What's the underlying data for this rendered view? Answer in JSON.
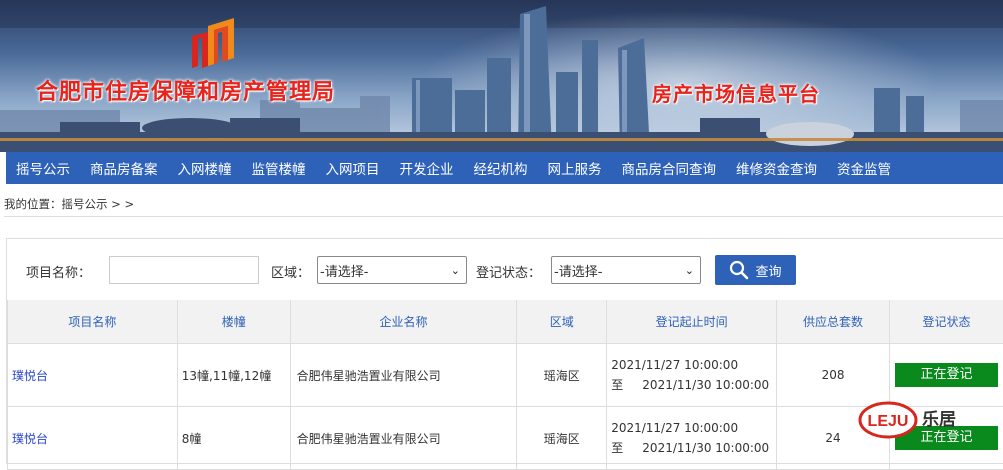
{
  "banner": {
    "title_left": "合肥市住房保障和房产管理局",
    "title_right": "房产市场信息平台",
    "logo_icon": "building-logo-icon"
  },
  "nav": {
    "items": [
      "摇号公示",
      "商品房备案",
      "入网楼幢",
      "监管楼幢",
      "入网项目",
      "开发企业",
      "经纪机构",
      "网上服务",
      "商品房合同查询",
      "维修资金查询",
      "资金监管"
    ]
  },
  "breadcrumb": "我的位置：摇号公示 > >",
  "search": {
    "project_label": "项目名称：",
    "project_value": "",
    "area_label": "区域：",
    "area_selected": "-请选择-",
    "status_label": "登记状态：",
    "status_selected": "-请选择-",
    "button_label": "查询"
  },
  "table": {
    "headers": [
      "项目名称",
      "楼幢",
      "企业名称",
      "区域",
      "登记起止时间",
      "供应总套数",
      "登记状态"
    ],
    "rows": [
      {
        "project": "璞悦台",
        "buildings": "13幢,11幢,12幢",
        "company": "合肥伟星驰浩置业有限公司",
        "area": "瑶海区",
        "start": "2021/11/27 10:00:00",
        "to": "至",
        "end": "2021/11/30 10:00:00",
        "total": "208",
        "status": "正在登记"
      },
      {
        "project": "璞悦台",
        "buildings": "8幢",
        "company": "合肥伟星驰浩置业有限公司",
        "area": "瑶海区",
        "start": "2021/11/27 10:00:00",
        "to": "至",
        "end": "2021/11/30 10:00:00",
        "total": "24",
        "status": "正在登记"
      }
    ]
  },
  "watermark": {
    "text": "乐居",
    "logo": "LEJU"
  },
  "colors": {
    "nav_blue": "#2e62b8",
    "title_red": "#e8231c",
    "status_green": "#0a8a1c",
    "link_blue": "#2a46c8"
  }
}
